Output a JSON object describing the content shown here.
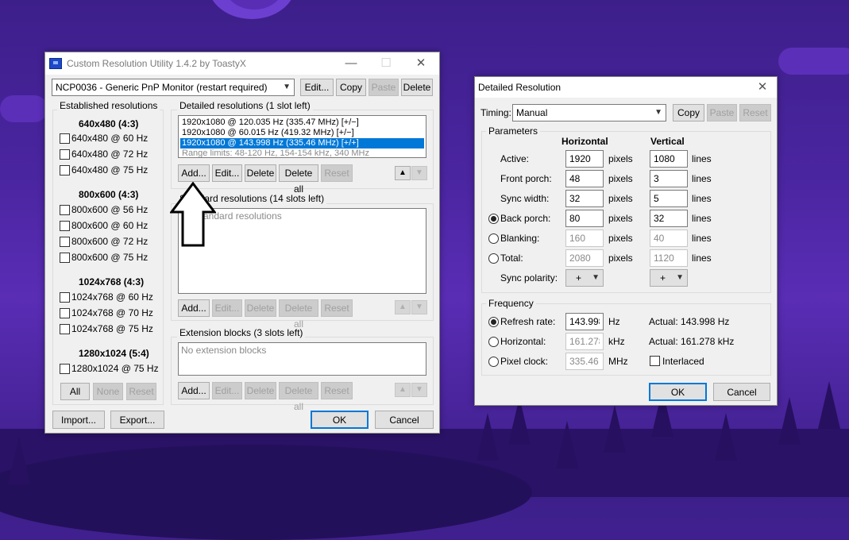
{
  "main_window": {
    "title": "Custom Resolution Utility 1.4.2 by ToastyX",
    "monitor_select": "NCP0036 - Generic PnP Monitor (restart required)",
    "top_buttons": {
      "edit": "Edit...",
      "copy": "Copy",
      "paste": "Paste",
      "delete": "Delete"
    },
    "established": {
      "label": "Established resolutions",
      "groups": [
        {
          "heading": "640x480 (4:3)",
          "items": [
            "640x480 @ 60 Hz",
            "640x480 @ 72 Hz",
            "640x480 @ 75 Hz"
          ]
        },
        {
          "heading": "800x600 (4:3)",
          "items": [
            "800x600 @ 56 Hz",
            "800x600 @ 60 Hz",
            "800x600 @ 72 Hz",
            "800x600 @ 75 Hz"
          ]
        },
        {
          "heading": "1024x768 (4:3)",
          "items": [
            "1024x768 @ 60 Hz",
            "1024x768 @ 70 Hz",
            "1024x768 @ 75 Hz"
          ]
        },
        {
          "heading": "1280x1024 (5:4)",
          "items": [
            "1280x1024 @ 75 Hz"
          ]
        }
      ],
      "buttons": {
        "all": "All",
        "none": "None",
        "reset": "Reset"
      }
    },
    "detailed": {
      "label": "Detailed resolutions (1 slot left)",
      "items": [
        "1920x1080 @ 120.035 Hz (335.47 MHz) [+/−]",
        "1920x1080 @ 60.015 Hz (419.32 MHz) [+/−]",
        "1920x1080 @ 143.998 Hz (335.46 MHz) [+/+]",
        "Range limits: 48-120 Hz, 154-154 kHz, 340 MHz"
      ],
      "buttons": {
        "add": "Add...",
        "edit": "Edit...",
        "delete": "Delete",
        "delete_all": "Delete all",
        "reset": "Reset"
      }
    },
    "standard": {
      "label": "Standard resolutions (14 slots left)",
      "empty": "No standard resolutions",
      "buttons": {
        "add": "Add...",
        "edit": "Edit...",
        "delete": "Delete",
        "delete_all": "Delete all",
        "reset": "Reset"
      }
    },
    "extension": {
      "label": "Extension blocks (3 slots left)",
      "empty": "No extension blocks",
      "buttons": {
        "add": "Add...",
        "edit": "Edit...",
        "delete": "Delete",
        "delete_all": "Delete all",
        "reset": "Reset"
      }
    },
    "bottom_buttons": {
      "import": "Import...",
      "export": "Export...",
      "ok": "OK",
      "cancel": "Cancel"
    }
  },
  "detail_window": {
    "title": "Detailed Resolution",
    "timing_label": "Timing:",
    "timing_value": "Manual",
    "top_buttons": {
      "copy": "Copy",
      "paste": "Paste",
      "reset": "Reset"
    },
    "parameters_label": "Parameters",
    "col_horizontal": "Horizontal",
    "col_vertical": "Vertical",
    "rows": [
      {
        "label": "Active:",
        "h": "1920",
        "v": "1080",
        "hu": "pixels",
        "vu": "lines",
        "disabled": false
      },
      {
        "label": "Front porch:",
        "h": "48",
        "v": "3",
        "hu": "pixels",
        "vu": "lines",
        "disabled": false
      },
      {
        "label": "Sync width:",
        "h": "32",
        "v": "5",
        "hu": "pixels",
        "vu": "lines",
        "disabled": false
      },
      {
        "label": "Back porch:",
        "h": "80",
        "v": "32",
        "hu": "pixels",
        "vu": "lines",
        "disabled": false
      },
      {
        "label": "Blanking:",
        "h": "160",
        "v": "40",
        "hu": "pixels",
        "vu": "lines",
        "disabled": true
      },
      {
        "label": "Total:",
        "h": "2080",
        "v": "1120",
        "hu": "pixels",
        "vu": "lines",
        "disabled": true
      }
    ],
    "sync_polarity_label": "Sync polarity:",
    "sync_h": "+",
    "sync_v": "+",
    "frequency_label": "Frequency",
    "refresh_label": "Refresh rate:",
    "refresh_value": "143.998",
    "refresh_unit": "Hz",
    "refresh_actual": "Actual: 143.998 Hz",
    "horizontal_label": "Horizontal:",
    "horizontal_value": "161.278",
    "horizontal_unit": "kHz",
    "horizontal_actual": "Actual: 161.278 kHz",
    "pixelclock_label": "Pixel clock:",
    "pixelclock_value": "335.46",
    "pixelclock_unit": "MHz",
    "interlaced_label": "Interlaced",
    "ok": "OK",
    "cancel": "Cancel"
  }
}
